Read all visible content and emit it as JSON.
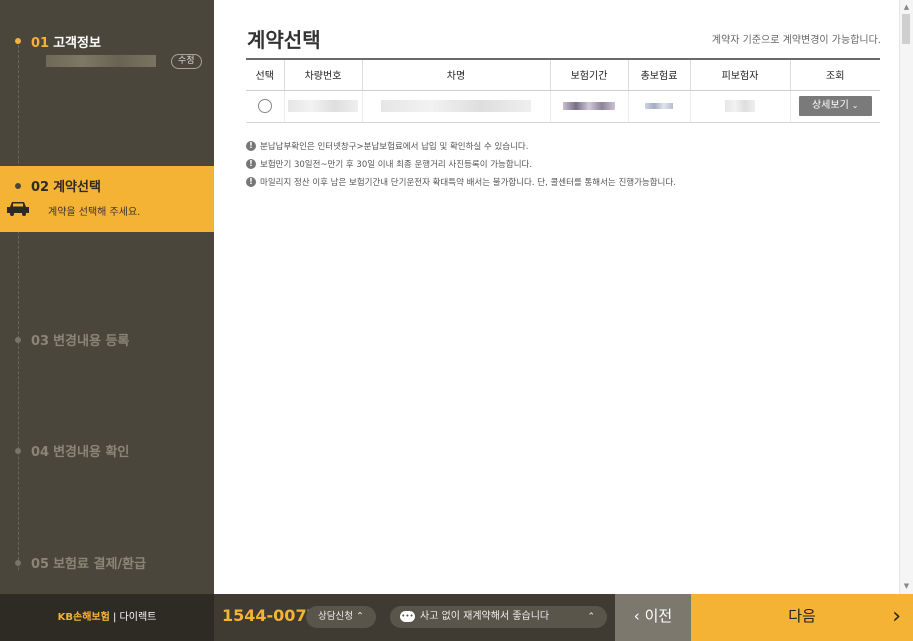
{
  "sidebar": {
    "steps": [
      {
        "num": "01",
        "label": "고객정보",
        "edit_label": "수정"
      },
      {
        "num": "02",
        "label": "계약선택",
        "sub": "계약을 선택해 주세요."
      },
      {
        "num": "03",
        "label": "변경내용 등록"
      },
      {
        "num": "04",
        "label": "변경내용 확인"
      },
      {
        "num": "05",
        "label": "보험료 결제/환급"
      }
    ]
  },
  "main": {
    "title": "계약선택",
    "notice": "계약자 기준으로 계약변경이 가능합니다.",
    "table": {
      "headers": [
        "선택",
        "차량번호",
        "차명",
        "보험기간",
        "총보험료",
        "피보험자",
        "조회"
      ],
      "detail_label": "상세보기"
    },
    "notes": [
      "분납납부확인은 인터넷창구>분납보험료에서 납입 및 확인하실 수 있습니다.",
      "보험만기 30일전~만기 후 30일 이내 최종 운행거리 사진등록이 가능합니다.",
      "마일리지 정산 이후 남은 보험기간내 단기운전자 확대특약 배서는 불가합니다. 단, 콜센터를 통해서는 진행가능합니다."
    ]
  },
  "footer": {
    "brand_kb": "KB손해보험",
    "brand_sep": "|",
    "brand_direct": "다이렉트",
    "phone": "1544-0077",
    "consult_label": "상담신청",
    "chat_label": "사고 없이 재계약해서 좋습니다",
    "prev_label": "이전",
    "next_label": "다음"
  },
  "colors": {
    "accent": "#f5b335",
    "sidebar_bg": "#4a463c",
    "footer_bg": "#3f3b33"
  },
  "icons": [
    "car-icon",
    "chevron-down-icon",
    "chevron-up-icon",
    "chat-bubble-icon",
    "chevron-left-icon",
    "chevron-right-icon",
    "info-icon"
  ]
}
